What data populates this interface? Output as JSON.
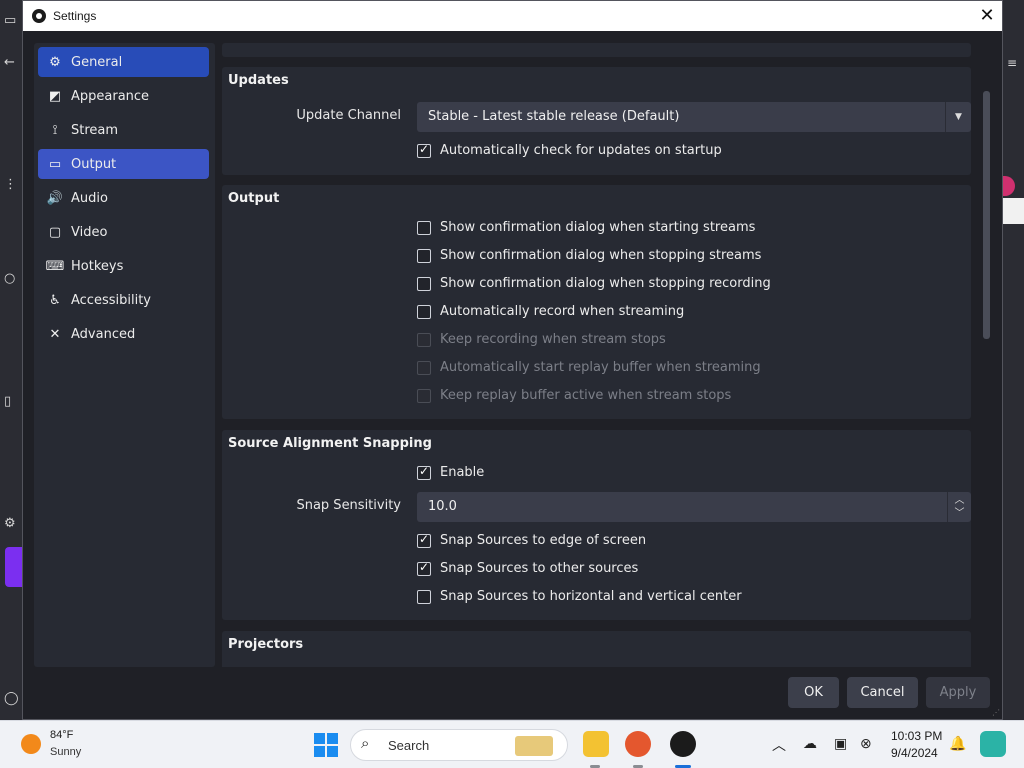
{
  "window": {
    "title": "Settings",
    "close_glyph": "✕"
  },
  "sidebar": {
    "items": [
      {
        "label": "General",
        "icon": "gear-icon",
        "glyph": "⚙"
      },
      {
        "label": "Appearance",
        "icon": "appearance-icon",
        "glyph": "◩"
      },
      {
        "label": "Stream",
        "icon": "antenna-icon",
        "glyph": "⟟"
      },
      {
        "label": "Output",
        "icon": "output-icon",
        "glyph": "▭"
      },
      {
        "label": "Audio",
        "icon": "speaker-icon",
        "glyph": "🔊"
      },
      {
        "label": "Video",
        "icon": "monitor-icon",
        "glyph": "▢"
      },
      {
        "label": "Hotkeys",
        "icon": "keyboard-icon",
        "glyph": "⌨"
      },
      {
        "label": "Accessibility",
        "icon": "accessibility-icon",
        "glyph": "♿"
      },
      {
        "label": "Advanced",
        "icon": "tools-icon",
        "glyph": "✕"
      }
    ],
    "selected": "General",
    "hovered": "Output"
  },
  "updates": {
    "title": "Updates",
    "channel_label": "Update Channel",
    "channel_value": "Stable - Latest stable release (Default)",
    "auto_check_label": "Automatically check for updates on startup",
    "auto_check": true
  },
  "output": {
    "title": "Output",
    "options": [
      {
        "label": "Show confirmation dialog when starting streams",
        "checked": false,
        "enabled": true
      },
      {
        "label": "Show confirmation dialog when stopping streams",
        "checked": false,
        "enabled": true
      },
      {
        "label": "Show confirmation dialog when stopping recording",
        "checked": false,
        "enabled": true
      },
      {
        "label": "Automatically record when streaming",
        "checked": false,
        "enabled": true
      },
      {
        "label": "Keep recording when stream stops",
        "checked": false,
        "enabled": false
      },
      {
        "label": "Automatically start replay buffer when streaming",
        "checked": false,
        "enabled": false
      },
      {
        "label": "Keep replay buffer active when stream stops",
        "checked": false,
        "enabled": false
      }
    ]
  },
  "snapping": {
    "title": "Source Alignment Snapping",
    "enable_label": "Enable",
    "enable": true,
    "sensitivity_label": "Snap Sensitivity",
    "sensitivity_value": "10.0",
    "options": [
      {
        "label": "Snap Sources to edge of screen",
        "checked": true
      },
      {
        "label": "Snap Sources to other sources",
        "checked": true
      },
      {
        "label": "Snap Sources to horizontal and vertical center",
        "checked": false
      }
    ]
  },
  "projectors": {
    "title": "Projectors"
  },
  "buttons": {
    "ok": "OK",
    "cancel": "Cancel",
    "apply": "Apply",
    "apply_enabled": false
  },
  "taskbar": {
    "weather_temp": "84°F",
    "weather_desc": "Sunny",
    "search_placeholder": "Search",
    "time": "10:03 PM",
    "date": "9/4/2024"
  },
  "colors": {
    "accent": "#284cb8",
    "hover": "#3c55c5",
    "window_bg": "#1f2026",
    "panel_bg": "#272a33"
  }
}
